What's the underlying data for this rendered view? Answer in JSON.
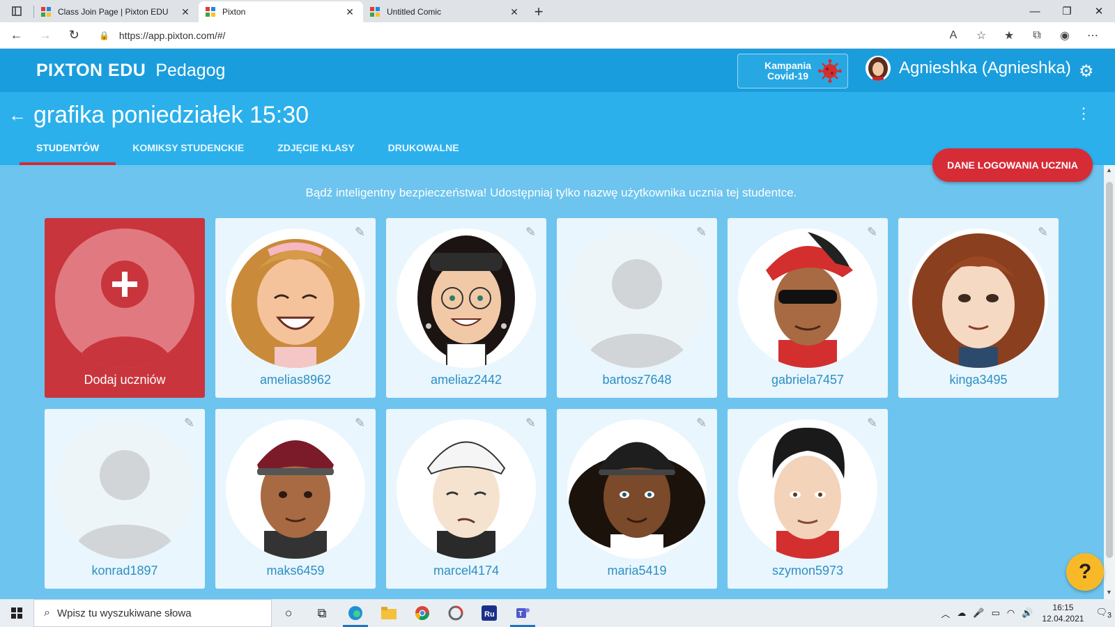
{
  "browser": {
    "tabs": [
      {
        "title": "Class Join Page | Pixton EDU",
        "active": false
      },
      {
        "title": "Pixton",
        "active": true
      },
      {
        "title": "Untitled Comic",
        "active": false
      }
    ],
    "url": "https://app.pixton.com/#/"
  },
  "header": {
    "brand": "PIXTON EDU",
    "role": "Pedagog",
    "campaign": {
      "line1": "Kampania",
      "line2": "Covid-19"
    },
    "user_name": "Agnieshka (Agnieshka)"
  },
  "class": {
    "name": "grafika poniedziałek 15:30",
    "tabs": [
      "STUDENTÓW",
      "KOMIKSY STUDENCKIE",
      "ZDJĘCIE KLASY",
      "DRUKOWALNE"
    ],
    "login_button": "DANE LOGOWANIA UCZNIA",
    "notice": "Bądź inteligentny bezpieczeństwa! Udostępniaj tylko nazwę użytkownika ucznia tej studentce."
  },
  "add_card": {
    "label": "Dodaj uczniów"
  },
  "students": [
    {
      "username": "amelias8962",
      "avatar": "girl-wavy-blonde-headband"
    },
    {
      "username": "ameliaz2442",
      "avatar": "girl-glasses-black-hair"
    },
    {
      "username": "bartosz7648",
      "avatar": "placeholder"
    },
    {
      "username": "gabriela7457",
      "avatar": "boy-red-cap-sunglasses"
    },
    {
      "username": "kinga3495",
      "avatar": "girl-curly-red-hair"
    },
    {
      "username": "konrad1897",
      "avatar": "placeholder"
    },
    {
      "username": "maks6459",
      "avatar": "boy-maroon-cap"
    },
    {
      "username": "marcel4174",
      "avatar": "boy-white-cap"
    },
    {
      "username": "maria5419",
      "avatar": "girl-black-cap-curly"
    },
    {
      "username": "szymon5973",
      "avatar": "boy-black-hair-red-hoodie"
    }
  ],
  "help": {
    "label": "?"
  },
  "taskbar": {
    "search_placeholder": "Wpisz tu wyszukiwane słowa",
    "time": "16:15",
    "date": "12.04.2021",
    "notification_count": "3"
  }
}
